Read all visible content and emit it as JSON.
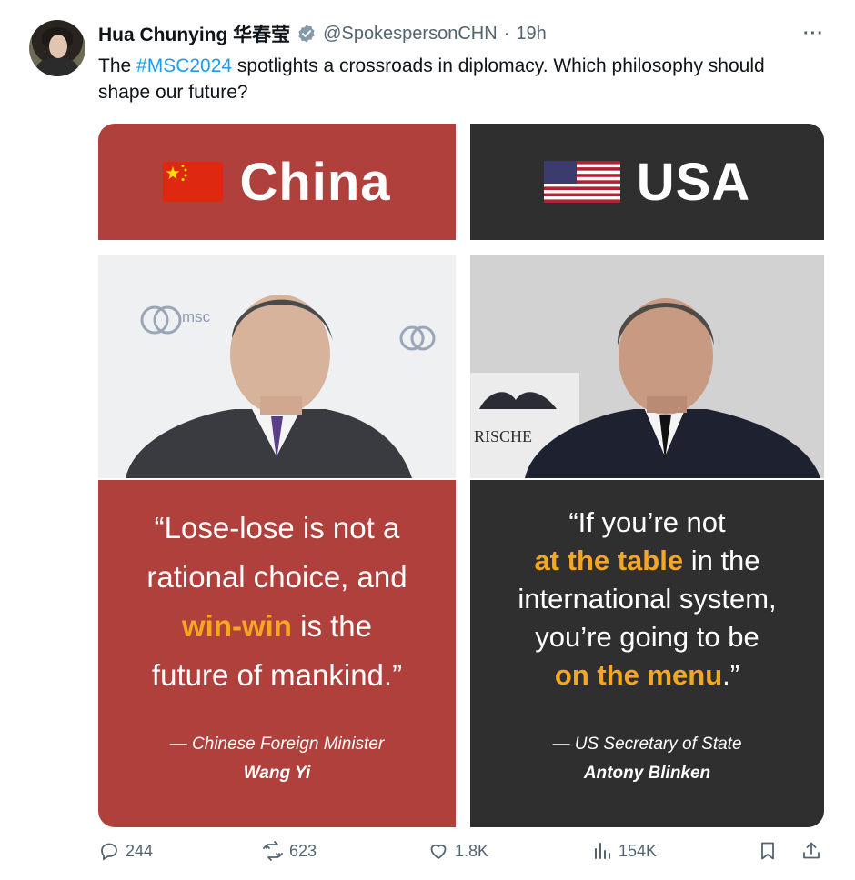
{
  "author": {
    "name": "Hua Chunying 华春莹",
    "handle": "@SpokespersonCHN",
    "separator": "·",
    "time": "19h"
  },
  "more_label": "···",
  "text": {
    "prefix": "The ",
    "hashtag": "#MSC2024",
    "rest": " spotlights a crossroads in diplomacy. Which philosophy should shape our future?"
  },
  "media": {
    "left": {
      "title": "China",
      "quote_l1": "“Lose-lose is not a",
      "quote_l2": "rational choice, and",
      "quote_hl": "win-win",
      "quote_l3b": " is the",
      "quote_l4": "future of mankind.”",
      "attrib_role": "— Chinese Foreign Minister",
      "attrib_name": "Wang Yi",
      "msc_logo": "msc"
    },
    "right": {
      "title": "USA",
      "quote_l1": "“If you’re not",
      "quote_hl1": "at the table",
      "quote_l2b": " in the",
      "quote_l3": "international system,",
      "quote_l4": "you’re going to be",
      "quote_hl2": "on the menu",
      "quote_l5b": ".”",
      "attrib_role": "— US Secretary of State",
      "attrib_name": "Antony Blinken",
      "backdrop_text": "RISCHE"
    },
    "colors": {
      "china": "#b0403c",
      "usa": "#2f2f2f",
      "highlight": "#f5a623"
    }
  },
  "actions": {
    "replies": "244",
    "reposts": "623",
    "likes": "1.8K",
    "views": "154K"
  },
  "icons": [
    "verified-icon",
    "more-icon",
    "reply-icon",
    "repost-icon",
    "like-icon",
    "views-icon",
    "bookmark-icon",
    "share-icon"
  ]
}
